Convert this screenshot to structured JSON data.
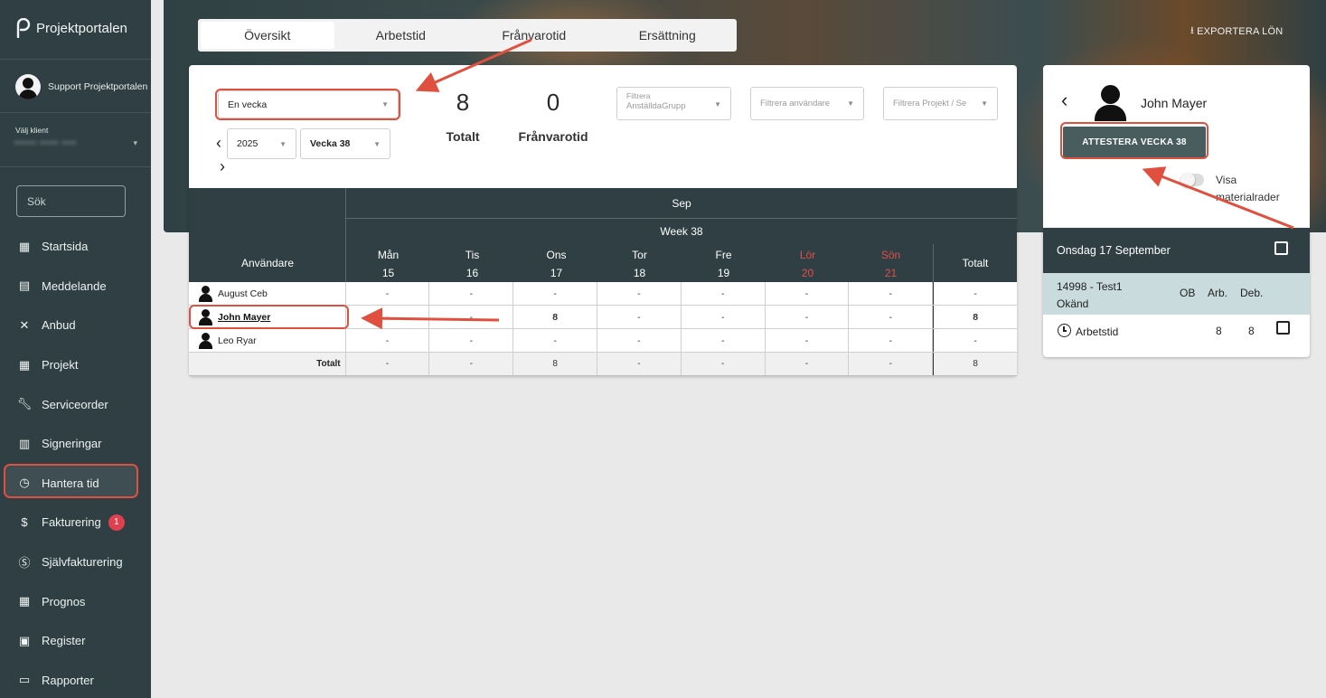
{
  "app": {
    "name": "Projektportalen"
  },
  "sidebar": {
    "user": "Support Projektportalen",
    "client_label": "Välj klient",
    "client_value": "•••••• ••••• ••••",
    "search_placeholder": "Sök",
    "items": [
      {
        "label": "Startsida",
        "icon": "grid-icon"
      },
      {
        "label": "Meddelande",
        "icon": "message-icon"
      },
      {
        "label": "Anbud",
        "icon": "tools-icon"
      },
      {
        "label": "Projekt",
        "icon": "grid-icon"
      },
      {
        "label": "Serviceorder",
        "icon": "wrench-icon"
      },
      {
        "label": "Signeringar",
        "icon": "signature-icon"
      },
      {
        "label": "Hantera tid",
        "icon": "clock-icon"
      },
      {
        "label": "Fakturering",
        "icon": "dollar-icon",
        "badge": "1"
      },
      {
        "label": "Självfakturering",
        "icon": "dollar-circle-icon"
      },
      {
        "label": "Prognos",
        "icon": "grid-icon"
      },
      {
        "label": "Register",
        "icon": "image-icon"
      },
      {
        "label": "Rapporter",
        "icon": "calendar-icon"
      }
    ]
  },
  "tabs": [
    "Översikt",
    "Arbetstid",
    "Frånvarotid",
    "Ersättning"
  ],
  "export_label": "EXPORTERA LÖN",
  "filters": {
    "period": "En vecka",
    "year": "2025",
    "week": "Vecka 38",
    "group_placeholder_1": "Filtrera",
    "group_placeholder_2": "AnställdaGrupp",
    "user_placeholder": "Filtrera användare",
    "project_placeholder": "Filtrera Projekt / Se"
  },
  "stats": {
    "total_value": "8",
    "total_label": "Totalt",
    "absence_value": "0",
    "absence_label": "Frånvarotid"
  },
  "table": {
    "month": "Sep",
    "week": "Week 38",
    "user_header": "Användare",
    "total_header": "Totalt",
    "days": [
      {
        "name": "Mån",
        "date": "15",
        "weekend": false
      },
      {
        "name": "Tis",
        "date": "16",
        "weekend": false
      },
      {
        "name": "Ons",
        "date": "17",
        "weekend": false
      },
      {
        "name": "Tor",
        "date": "18",
        "weekend": false
      },
      {
        "name": "Fre",
        "date": "19",
        "weekend": false
      },
      {
        "name": "Lör",
        "date": "20",
        "weekend": true
      },
      {
        "name": "Sön",
        "date": "21",
        "weekend": true
      }
    ],
    "rows": [
      {
        "user": "August Ceb",
        "values": [
          "-",
          "-",
          "-",
          "-",
          "-",
          "-",
          "-"
        ],
        "total": "-"
      },
      {
        "user": "John Mayer",
        "values": [
          "-",
          "-",
          "8",
          "-",
          "-",
          "-",
          "-"
        ],
        "total": "8"
      },
      {
        "user": "Leo Ryar",
        "values": [
          "-",
          "-",
          "-",
          "-",
          "-",
          "-",
          "-"
        ],
        "total": "-"
      }
    ],
    "footer": {
      "label": "Totalt",
      "values": [
        "-",
        "-",
        "8",
        "-",
        "-",
        "-",
        "-"
      ],
      "total": "8"
    }
  },
  "panel": {
    "name": "John Mayer",
    "attest_button": "ATTESTERA VECKA 38",
    "toggle_label": "Visa materialrader",
    "day_header": "Onsdag 17 September",
    "project_line1": "14998 - Test1",
    "project_line2": "Okänd",
    "col_ob": "OB",
    "col_arb": "Arb.",
    "col_deb": "Deb.",
    "work_label": "Arbetstid",
    "work_arb": "8",
    "work_deb": "8"
  },
  "colors": {
    "sidebar": "#2f3f43",
    "annotation_red": "#e0503f",
    "weekend_red": "#e0504a",
    "attest_button": "#4a5d5e"
  }
}
